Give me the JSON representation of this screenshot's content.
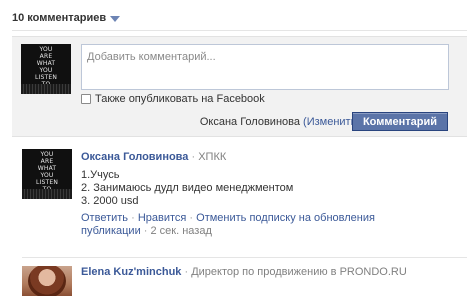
{
  "header": {
    "title": "10 комментариев",
    "caret_icon": "chevron-down-icon"
  },
  "avatar_text": [
    "YOU",
    "ARE",
    "WHAT",
    "YOU",
    "LISTEN",
    "TO"
  ],
  "composer": {
    "placeholder": "Добавить комментарий...",
    "also_post_label": "Также опубликовать на Facebook",
    "posting_as": "Оксана Головинова",
    "change_link": "(Изменить)",
    "submit_label": "Комментарий"
  },
  "comments": [
    {
      "author": "Оксана Головинова",
      "separator": " · ",
      "affiliation": "ХПКК",
      "lines": [
        "1.Учусь",
        "2. Занимаюсь дудл видео менеджментом",
        "3. 2000 usd"
      ],
      "actions": {
        "reply": "Ответить",
        "like": "Нравится",
        "unsubscribe": "Отменить подписку на обновления публикации",
        "time": "2 сек. назад"
      }
    },
    {
      "author": "Elena Kuz'minchuk",
      "separator": " · ",
      "affiliation": "Директор по продвижению в PRONDO.RU"
    }
  ],
  "colors": {
    "link": "#3b5998",
    "button": "#5b74a8",
    "composer_bg": "#f2f2f2"
  }
}
